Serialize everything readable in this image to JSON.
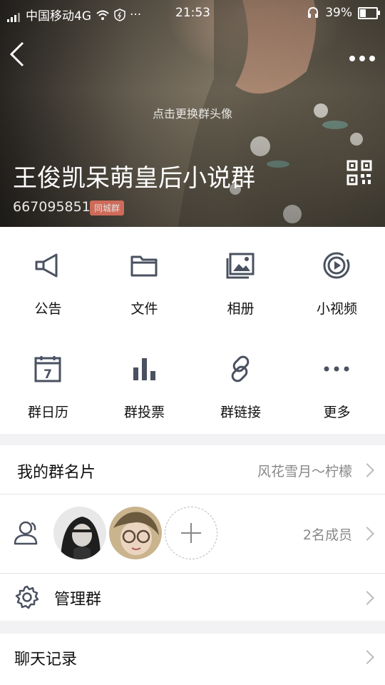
{
  "status_bar": {
    "carrier": "中国移动4G",
    "time": "21:53",
    "battery": "39%"
  },
  "header": {
    "change_avatar_hint": "点击更换群头像",
    "group_name": "王俊凯呆萌皇后小说群",
    "group_id": "667095851",
    "tag": "同城群"
  },
  "features": [
    {
      "label": "公告",
      "icon": "megaphone-icon"
    },
    {
      "label": "文件",
      "icon": "folder-icon"
    },
    {
      "label": "相册",
      "icon": "album-icon"
    },
    {
      "label": "小视频",
      "icon": "video-icon"
    },
    {
      "label": "群日历",
      "icon": "calendar-icon"
    },
    {
      "label": "群投票",
      "icon": "vote-icon"
    },
    {
      "label": "群链接",
      "icon": "link-icon"
    },
    {
      "label": "更多",
      "icon": "more-icon"
    }
  ],
  "calendar_day": "7",
  "card": {
    "title": "我的群名片",
    "value": "风花雪月～柠檬"
  },
  "members": {
    "count_label": "2名成员"
  },
  "manage": {
    "title": "管理群"
  },
  "chat_history": {
    "title": "聊天记录"
  },
  "colors": {
    "icon_color": "#4a5160",
    "tag_color": "#e8735f"
  }
}
